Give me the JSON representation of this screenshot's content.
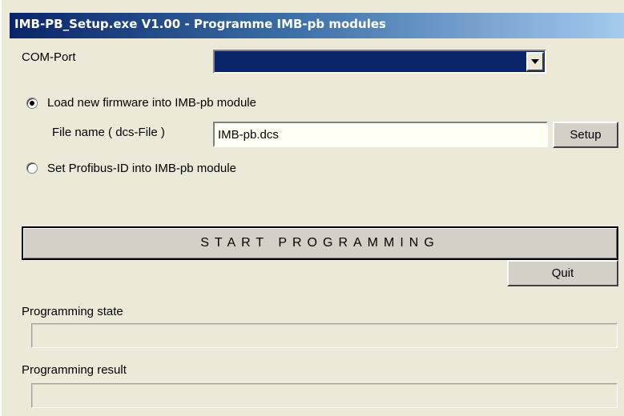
{
  "window": {
    "title": "IMB-PB_Setup.exe  V1.00  -  Programme IMB-pb modules"
  },
  "com_port": {
    "label": "COM-Port",
    "selected_value": ""
  },
  "firmware_option": {
    "label": "Load new firmware into IMB-pb module",
    "selected": true
  },
  "file_name": {
    "label": "File name ( dcs-File )",
    "value": "IMB-pb.dcs",
    "setup_label": "Setup"
  },
  "profibus_option": {
    "label": "Set Profibus-ID into IMB-pb module",
    "selected": false
  },
  "actions": {
    "start_label": "START   PROGRAMMING",
    "quit_label": "Quit"
  },
  "programming_state": {
    "label": "Programming state",
    "value": ""
  },
  "programming_result": {
    "label": "Programming result",
    "value": ""
  },
  "icons": {
    "combo_arrow": "chevron-down-icon"
  },
  "colors": {
    "title_gradient_start": "#0a246a",
    "title_gradient_end": "#a6caf0",
    "combo_selection": "#0a246a",
    "window_bg": "#ece9d8"
  }
}
